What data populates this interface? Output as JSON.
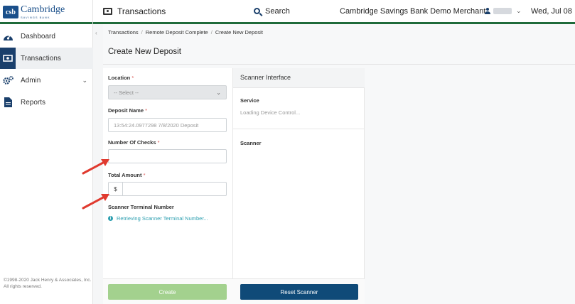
{
  "header": {
    "logo_mark": "csb",
    "logo_name": "Cambridge",
    "logo_sub": "SAVINGS BANK",
    "nav_transactions": "Transactions",
    "search_label": "Search",
    "merchant": "Cambridge Savings Bank Demo Merchant",
    "date": "Wed, Jul 08"
  },
  "sidebar": {
    "items": [
      {
        "label": "Dashboard",
        "icon": "dashboard-icon"
      },
      {
        "label": "Transactions",
        "icon": "money-icon"
      },
      {
        "label": "Admin",
        "icon": "gears-icon"
      },
      {
        "label": "Reports",
        "icon": "document-icon"
      }
    ],
    "copyright": "©1998-2020 Jack Henry & Associates, Inc. All rights reserved."
  },
  "breadcrumb": [
    "Transactions",
    "Remote Deposit Complete",
    "Create New Deposit"
  ],
  "page_title": "Create New Deposit",
  "form": {
    "location_label": "Location",
    "location_value": "-- Select --",
    "deposit_name_label": "Deposit Name",
    "deposit_name_placeholder": "13:54:24.0977298 7/8/2020 Deposit",
    "checks_label": "Number Of Checks",
    "total_label": "Total Amount",
    "currency": "$",
    "terminal_label": "Scanner Terminal Number",
    "terminal_status": "Retrieving Scanner Terminal Number...",
    "required_mark": "*",
    "create_button": "Create"
  },
  "scanner": {
    "title": "Scanner Interface",
    "service_label": "Service",
    "service_value": "Loading Device Control...",
    "scanner_label": "Scanner",
    "reset_button": "Reset Scanner"
  },
  "colors": {
    "brand_green": "#1f6b3a",
    "brand_navy": "#1a3f6b",
    "create_green": "#a3d18e",
    "reset_blue": "#0f4a78",
    "annotation_red": "#e03a2f"
  }
}
